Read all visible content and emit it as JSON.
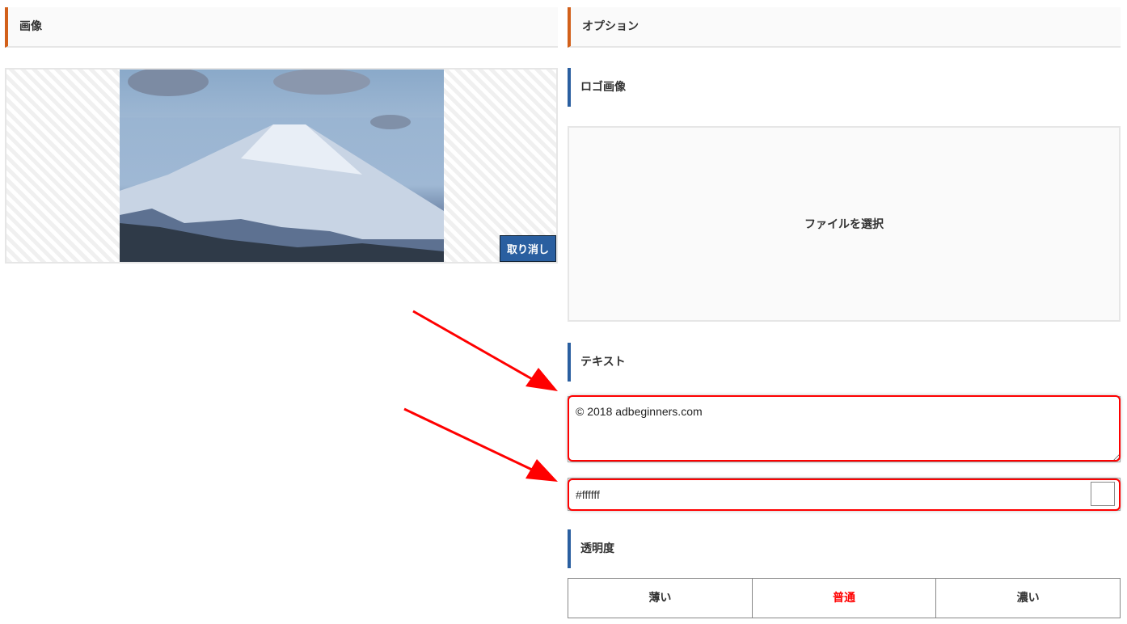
{
  "left": {
    "title": "画像",
    "cancel_label": "取り消し"
  },
  "right": {
    "title": "オプション",
    "logo": {
      "title": "ロゴ画像",
      "file_label": "ファイルを選択"
    },
    "text": {
      "title": "テキスト",
      "value": "© 2018 adbeginners.com",
      "color_value": "#ffffff"
    },
    "opacity": {
      "title": "透明度",
      "options": [
        "薄い",
        "普通",
        "濃い"
      ],
      "selected": "普通"
    }
  },
  "colors": {
    "accent_orange": "#d2601a",
    "accent_blue": "#2a5fa0",
    "highlight": "#ff0000"
  }
}
